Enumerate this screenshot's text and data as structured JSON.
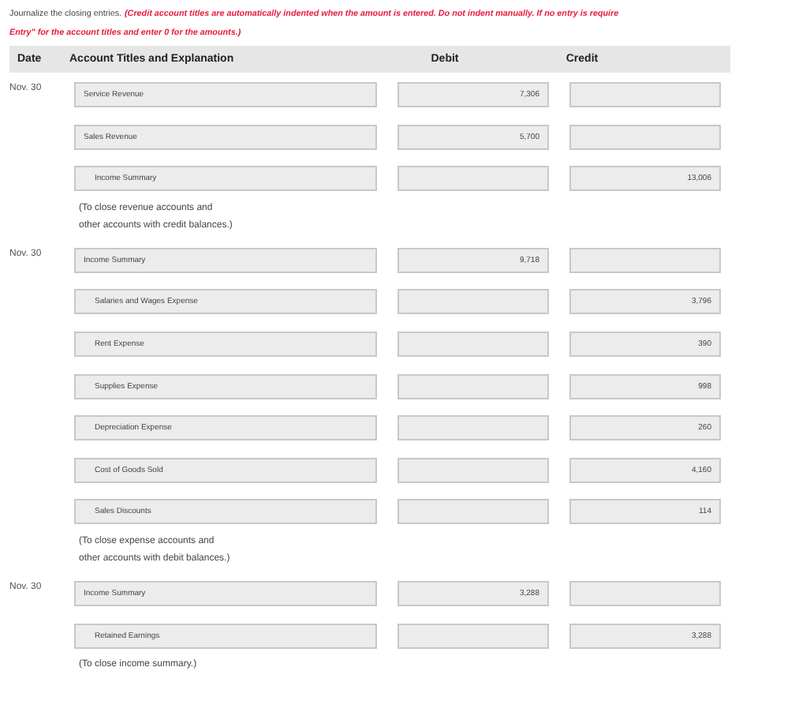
{
  "instructions": {
    "lead": "Journalize the closing entries.",
    "note_line_1": "(Credit account titles are automatically indented when the amount is entered. Do not indent manually. If no entry is require",
    "note_line_2": "Entry\" for the account titles and enter 0 for the amounts.)"
  },
  "table": {
    "columns": [
      "Date",
      "Account Titles and Explanation",
      "Debit",
      "Credit"
    ],
    "entries": [
      {
        "date": "Nov. 30",
        "lines": [
          {
            "account": "Service Revenue",
            "indented": false,
            "debit": "7,306"
          },
          {
            "account": "Sales Revenue",
            "indented": false,
            "debit": "5,700"
          },
          {
            "account": "Income Summary",
            "indented": true,
            "credit": "13,006"
          }
        ],
        "explanation": [
          "(To close revenue accounts and",
          "other accounts with credit balances.)"
        ]
      },
      {
        "date": "Nov. 30",
        "lines": [
          {
            "account": "Income Summary",
            "indented": false,
            "debit": "9,718"
          },
          {
            "account": "Salaries and Wages Expense",
            "indented": true,
            "credit": "3,796"
          },
          {
            "account": "Rent Expense",
            "indented": true,
            "credit": "390"
          },
          {
            "account": "Supplies Expense",
            "indented": true,
            "credit": "998"
          },
          {
            "account": "Depreciation Expense",
            "indented": true,
            "credit": "260"
          },
          {
            "account": "Cost of Goods Sold",
            "indented": true,
            "credit": "4,160"
          },
          {
            "account": "Sales Discounts",
            "indented": true,
            "credit": "114"
          }
        ],
        "explanation": [
          "(To close expense accounts and",
          "other accounts with debit balances.)"
        ]
      },
      {
        "date": "Nov. 30",
        "lines": [
          {
            "account": "Income Summary",
            "indented": false,
            "debit": "3,288"
          },
          {
            "account": "Retained Earnings",
            "indented": true,
            "credit": "3,288"
          }
        ],
        "explanation": [
          "(To close income summary.)"
        ]
      }
    ]
  }
}
